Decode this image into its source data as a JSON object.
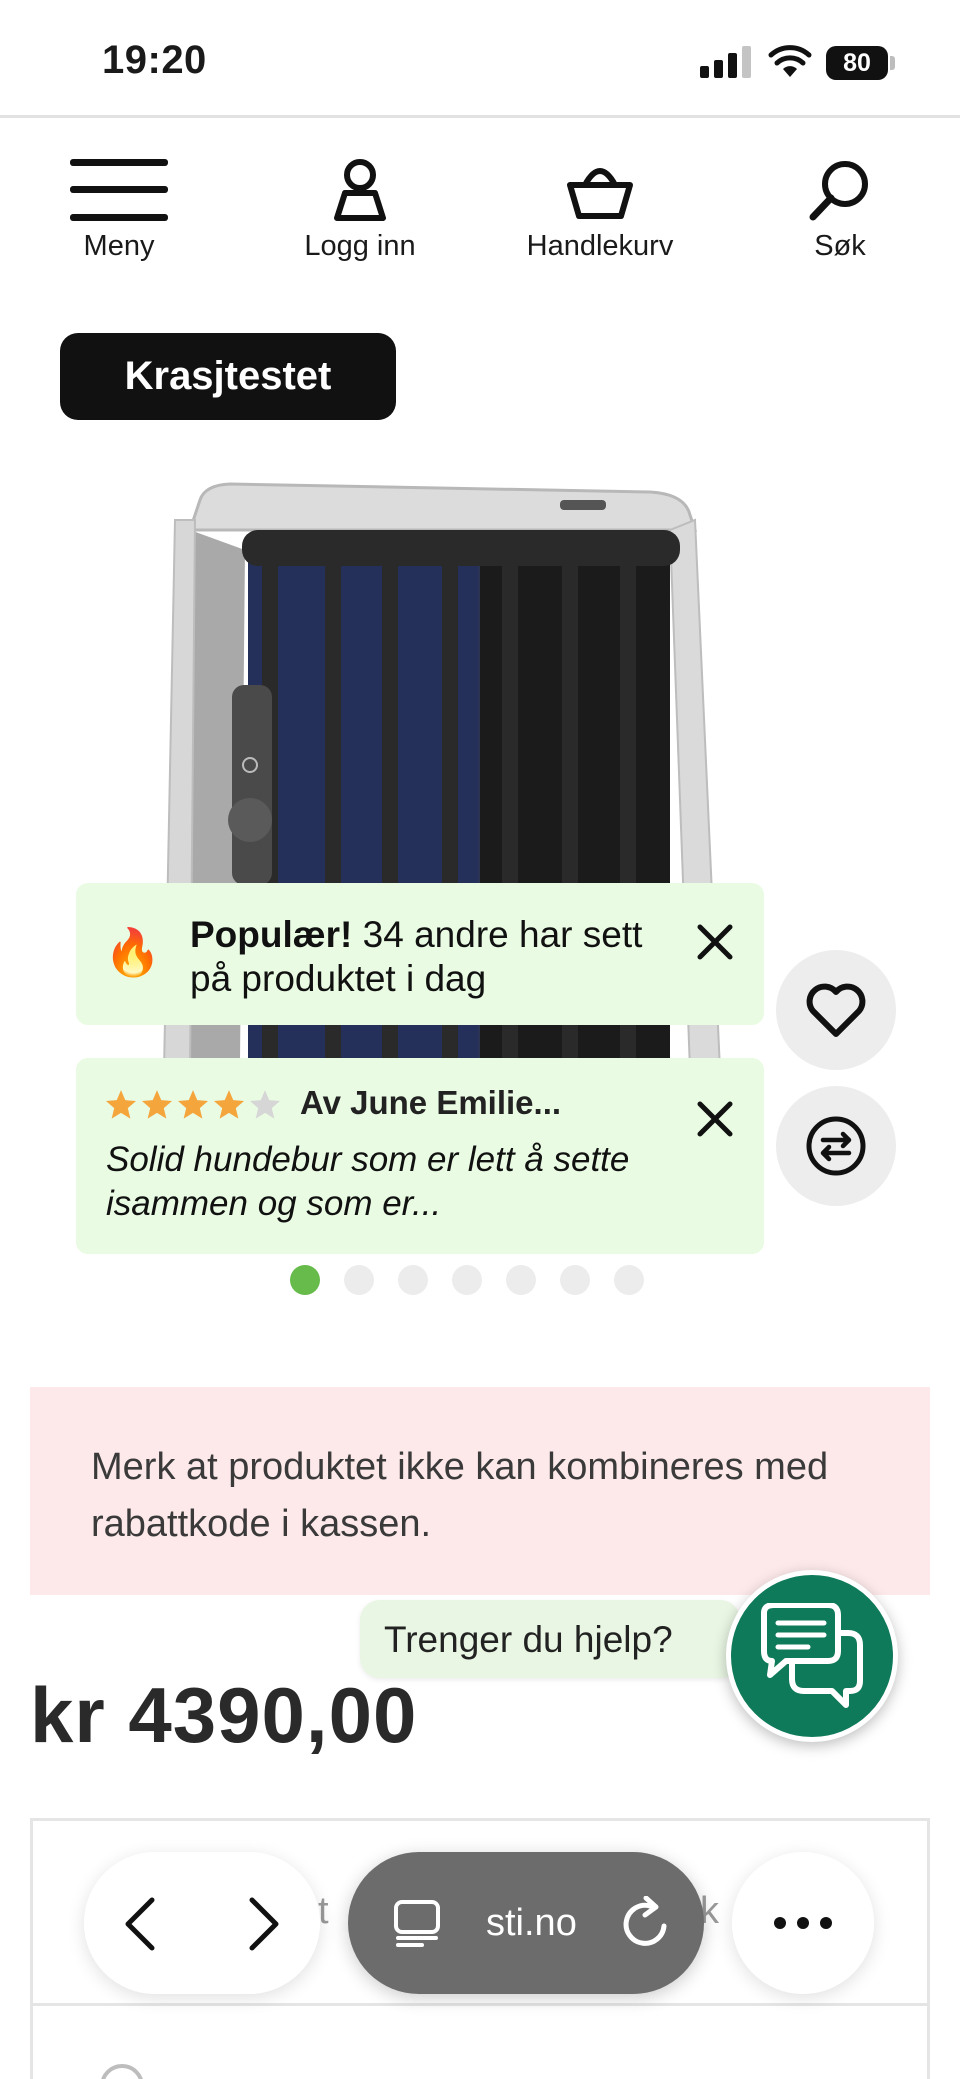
{
  "status": {
    "time": "19:20",
    "battery": "80"
  },
  "nav": {
    "menu": "Meny",
    "login": "Logg inn",
    "cart": "Handlekurv",
    "search": "Søk"
  },
  "badge": "Krasjtestet",
  "toasts": {
    "popular_bold": "Populær!",
    "popular_rest": " 34 andre har sett på produktet i dag",
    "review_rating": 4,
    "review_author": "Av June Emilie...",
    "review_text": "Solid hundebur som er lett å sette isammen og som er..."
  },
  "carousel": {
    "total": 7,
    "active": 1
  },
  "notice": "Merk at produktet ikke kan kombineres med rabattkode i kassen.",
  "help": "Trenger du hjelp?",
  "price": "kr 4390,00",
  "options": {
    "left_fragment": "t",
    "right_fragment": "k"
  },
  "browser": {
    "url": "sti.no"
  },
  "colors": {
    "accent_green": "#66bb4a",
    "chat_green": "#0f7a5a",
    "toast_bg": "#e9fbe3",
    "notice_bg": "#fde9ea",
    "star": "#f4a53c"
  },
  "icons": {
    "menu": "hamburger-icon",
    "login": "user-icon",
    "cart": "basket-icon",
    "search": "search-icon",
    "favorite": "heart-icon",
    "compare": "compare-arrows-icon",
    "chat": "chat-bubbles-icon"
  }
}
